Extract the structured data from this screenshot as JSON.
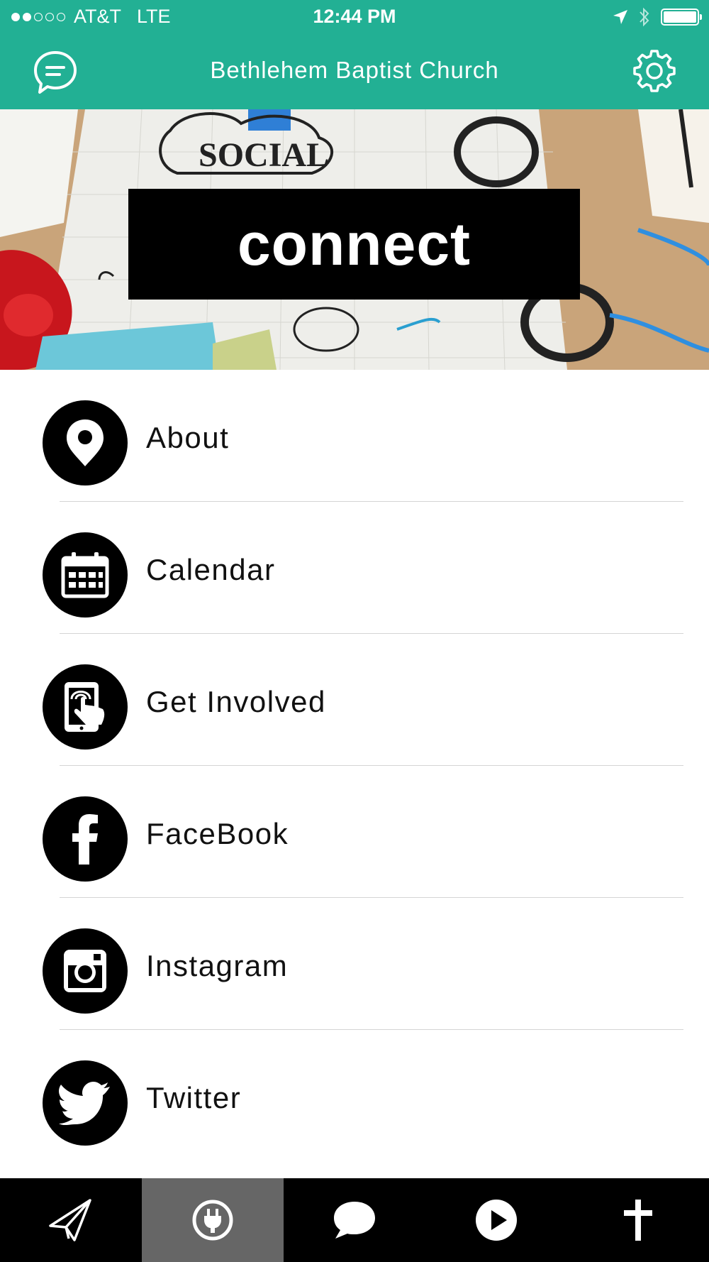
{
  "status_bar": {
    "carrier": "AT&T",
    "network": "LTE",
    "time": "12:44 PM",
    "signal_bars_filled": 2,
    "signal_bars_total": 5
  },
  "header": {
    "title": "Bethlehem Baptist Church",
    "left_icon": "chat-bubble-icon",
    "right_icon": "gear-icon"
  },
  "banner": {
    "caption": "connect"
  },
  "menu": {
    "items": [
      {
        "label": "About",
        "icon": "map-pin-icon"
      },
      {
        "label": "Calendar",
        "icon": "calendar-icon"
      },
      {
        "label": "Get Involved",
        "icon": "tablet-tap-icon"
      },
      {
        "label": "FaceBook",
        "icon": "facebook-icon"
      },
      {
        "label": "Instagram",
        "icon": "instagram-icon"
      },
      {
        "label": "Twitter",
        "icon": "twitter-icon"
      }
    ]
  },
  "tab_bar": {
    "tabs": [
      {
        "icon": "paper-plane-icon",
        "active": false
      },
      {
        "icon": "plug-icon",
        "active": true
      },
      {
        "icon": "speech-bubble-icon",
        "active": false
      },
      {
        "icon": "play-icon",
        "active": false
      },
      {
        "icon": "cross-icon",
        "active": false
      }
    ]
  },
  "colors": {
    "accent": "#22b094",
    "tab_bar": "#000000",
    "tab_active": "#666666"
  }
}
